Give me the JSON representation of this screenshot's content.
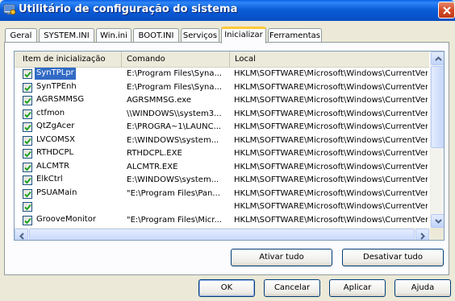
{
  "window": {
    "title": "Utilitário de configuração do sistema",
    "title_icon": "msconfig-icon",
    "close_icon": "close-icon"
  },
  "tabs": [
    {
      "label": "Geral",
      "active": false
    },
    {
      "label": "SYSTEM.INI",
      "active": false
    },
    {
      "label": "Win.ini",
      "active": false
    },
    {
      "label": "BOOT.INI",
      "active": false
    },
    {
      "label": "Serviços",
      "active": false
    },
    {
      "label": "Inicializar",
      "active": true
    },
    {
      "label": "Ferramentas",
      "active": false
    }
  ],
  "startup_list": {
    "columns": [
      "Item de inicialização",
      "Comando",
      "Local"
    ],
    "rows": [
      {
        "checked": true,
        "name": "SynTPLpr",
        "command": "E:\\Program Files\\Syna...",
        "location": "HKLM\\SOFTWARE\\Microsoft\\Windows\\CurrentVer...",
        "selected": true
      },
      {
        "checked": true,
        "name": "SynTPEnh",
        "command": "E:\\Program Files\\Syna...",
        "location": "HKLM\\SOFTWARE\\Microsoft\\Windows\\CurrentVer...",
        "selected": false
      },
      {
        "checked": true,
        "name": "AGRSMMSG",
        "command": "AGRSMMSG.exe",
        "location": "HKLM\\SOFTWARE\\Microsoft\\Windows\\CurrentVer...",
        "selected": false
      },
      {
        "checked": true,
        "name": "ctfmon",
        "command": "\\\\WINDOWS\\\\system3...",
        "location": "HKLM\\SOFTWARE\\Microsoft\\Windows\\CurrentVer...",
        "selected": false
      },
      {
        "checked": true,
        "name": "QtZgAcer",
        "command": "E:\\PROGRA~1\\LAUNC...",
        "location": "HKLM\\SOFTWARE\\Microsoft\\Windows\\CurrentVer...",
        "selected": false
      },
      {
        "checked": true,
        "name": "LVCOMSX",
        "command": "E:\\WINDOWS\\system...",
        "location": "HKLM\\SOFTWARE\\Microsoft\\Windows\\CurrentVer...",
        "selected": false
      },
      {
        "checked": true,
        "name": "RTHDCPL",
        "command": "RTHDCPL.EXE",
        "location": "HKLM\\SOFTWARE\\Microsoft\\Windows\\CurrentVer...",
        "selected": false
      },
      {
        "checked": true,
        "name": "ALCMTR",
        "command": "ALCMTR.EXE",
        "location": "HKLM\\SOFTWARE\\Microsoft\\Windows\\CurrentVer...",
        "selected": false
      },
      {
        "checked": true,
        "name": "ElkCtrl",
        "command": "E:\\WINDOWS\\system...",
        "location": "HKLM\\SOFTWARE\\Microsoft\\Windows\\CurrentVer...",
        "selected": false
      },
      {
        "checked": true,
        "name": "PSUAMain",
        "command": "\"E:\\Program Files\\Pan...",
        "location": "HKLM\\SOFTWARE\\Microsoft\\Windows\\CurrentVer...",
        "selected": false
      },
      {
        "checked": true,
        "name": "",
        "command": "",
        "location": "HKLM\\SOFTWARE\\Microsoft\\Windows\\CurrentVer...",
        "selected": false
      },
      {
        "checked": true,
        "name": "GrooveMonitor",
        "command": "\"E:\\Program Files\\Micr...",
        "location": "HKLM\\SOFTWARE\\Microsoft\\Windows\\CurrentVer...",
        "selected": false
      }
    ]
  },
  "buttons": {
    "enable_all": "Ativar tudo",
    "disable_all": "Desativar tudo",
    "ok": "OK",
    "cancel": "Cancelar",
    "apply": "Aplicar",
    "help": "Ajuda"
  }
}
